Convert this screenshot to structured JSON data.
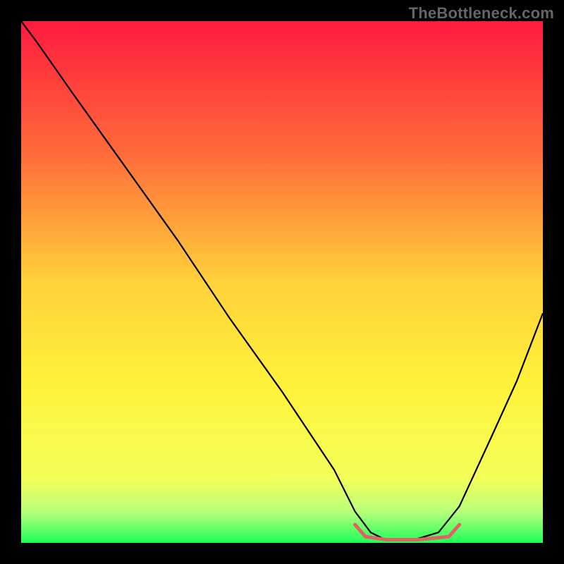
{
  "watermark": "TheBottleneck.com",
  "chart_data": {
    "type": "line",
    "title": "",
    "xlabel": "",
    "ylabel": "",
    "xlim": [
      0,
      100
    ],
    "ylim": [
      0,
      100
    ],
    "grid": false,
    "legend": false,
    "annotations": [],
    "axes_visible": false,
    "gradient_stops": [
      {
        "offset": 0.0,
        "color": "#ff1a3e"
      },
      {
        "offset": 0.25,
        "color": "#ff6a3a"
      },
      {
        "offset": 0.5,
        "color": "#ffd13a"
      },
      {
        "offset": 0.7,
        "color": "#fff23a"
      },
      {
        "offset": 0.88,
        "color": "#f3ff5a"
      },
      {
        "offset": 0.94,
        "color": "#b8ff7a"
      },
      {
        "offset": 1.0,
        "color": "#1fff5a"
      }
    ],
    "series": [
      {
        "name": "curve",
        "stroke": "#000000",
        "width": 2.2,
        "x": [
          0,
          3,
          10,
          20,
          30,
          40,
          50,
          60,
          64,
          67,
          70,
          75,
          80,
          84,
          90,
          95,
          100
        ],
        "y": [
          100,
          96,
          86,
          72,
          58,
          43,
          29,
          14,
          6,
          2,
          0.5,
          0.5,
          2,
          7,
          20,
          31,
          44
        ]
      }
    ],
    "valley_marker": {
      "stroke": "#e06363",
      "width": 5,
      "x": [
        64,
        66,
        70,
        76,
        82,
        84
      ],
      "y": [
        3.5,
        1.2,
        0.6,
        0.6,
        1.2,
        3.5
      ]
    }
  }
}
